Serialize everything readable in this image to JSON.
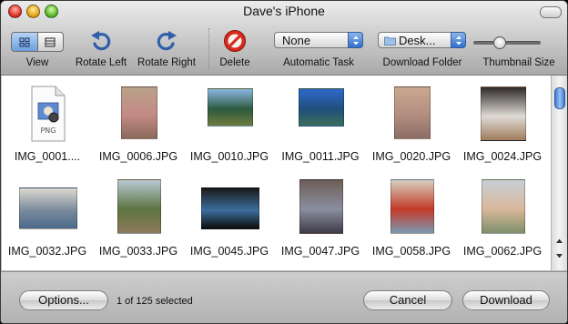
{
  "window": {
    "title": "Dave's iPhone"
  },
  "toolbar": {
    "view_label": "View",
    "rotate_left_label": "Rotate Left",
    "rotate_right_label": "Rotate Right",
    "delete_label": "Delete",
    "auto_task_label": "Automatic Task",
    "auto_task_value": "None",
    "download_folder_label": "Download Folder",
    "download_folder_value": "Desk...",
    "thumbnail_size_label": "Thumbnail Size",
    "thumbnail_size_level": 0.35
  },
  "items": [
    {
      "name": "IMG_0001....",
      "icon": "png-file-icon"
    },
    {
      "name": "IMG_0006.JPG",
      "colors": [
        "#b9a18a",
        "#c48a86",
        "#8a6a5c"
      ]
    },
    {
      "name": "IMG_0010.JPG",
      "colors": [
        "#8cb7e2",
        "#2c5a3e",
        "#6f7d3f"
      ]
    },
    {
      "name": "IMG_0011.JPG",
      "colors": [
        "#2f69c9",
        "#1f4e7b",
        "#3d6f5a"
      ]
    },
    {
      "name": "IMG_0020.JPG",
      "colors": [
        "#c9a88f",
        "#b38d80",
        "#8b6d65"
      ]
    },
    {
      "name": "IMG_0024.JPG",
      "colors": [
        "#2f2a29",
        "#dedad4",
        "#a07d5e"
      ]
    },
    {
      "name": "IMG_0032.JPG",
      "colors": [
        "#ddd8d0",
        "#7a8a9c",
        "#4a6a8a"
      ]
    },
    {
      "name": "IMG_0033.JPG",
      "colors": [
        "#b7c8d3",
        "#5e7440",
        "#8d7a5a"
      ]
    },
    {
      "name": "IMG_0045.JPG",
      "colors": [
        "#1a1a1a",
        "#3c6e9c",
        "#0d0d0d"
      ]
    },
    {
      "name": "IMG_0047.JPG",
      "colors": [
        "#6e5e56",
        "#8a8ea0",
        "#3f3b47"
      ]
    },
    {
      "name": "IMG_0058.JPG",
      "colors": [
        "#d6d0bf",
        "#c43a28",
        "#7a99b2"
      ]
    },
    {
      "name": "IMG_0062.JPG",
      "colors": [
        "#c8cfd6",
        "#d9b89a",
        "#7d8f6a"
      ]
    }
  ],
  "status": {
    "selected_text": "1 of 125 selected"
  },
  "buttons": {
    "options": "Options...",
    "cancel": "Cancel",
    "download": "Download"
  }
}
